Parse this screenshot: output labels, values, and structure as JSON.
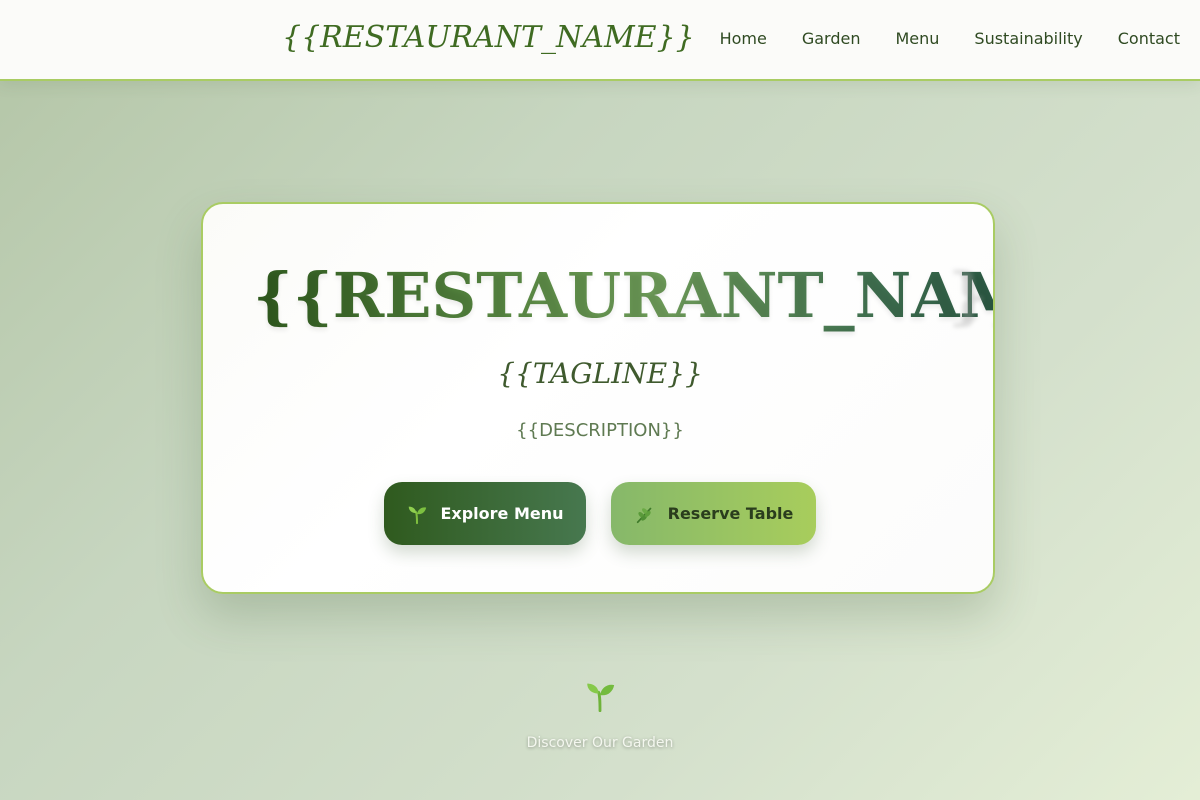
{
  "header": {
    "logo": "{{RESTAURANT_NAME}}",
    "nav": [
      {
        "label": "Home"
      },
      {
        "label": "Garden"
      },
      {
        "label": "Menu"
      },
      {
        "label": "Sustainability"
      },
      {
        "label": "Contact"
      }
    ]
  },
  "hero": {
    "title": "{{RESTAURANT_NAME",
    "title_faded": "}}",
    "tagline": "{{TAGLINE}}",
    "description": "{{DESCRIPTION}}",
    "primary_button": {
      "label": "Explore Menu",
      "icon": "seedling-icon"
    },
    "secondary_button": {
      "label": "Reserve Table",
      "icon": "herb-icon"
    }
  },
  "scroll_hint": {
    "label": "Discover Our Garden",
    "icon": "seedling-icon"
  },
  "colors": {
    "brand_dark": "#2f5a1e",
    "brand_light": "#a8cd5c",
    "accent_border": "#a9cc63",
    "nav_text": "#2f4a22"
  }
}
